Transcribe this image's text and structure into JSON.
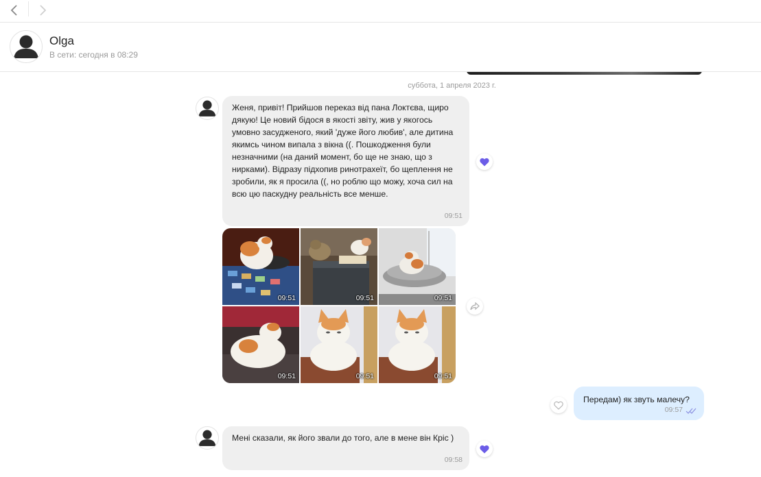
{
  "contact": {
    "name": "Olga",
    "status": "В сети: сегодня в 08:29"
  },
  "chat": {
    "date_separator": "суббота, 1 апреля 2023 г.",
    "messages": [
      {
        "direction": "in",
        "text": "Женя, привіт! Прийшов переказ від пана Локтєва, щиро дякую! Це новий бідося в якості звіту, жив у якогось умовно засудженого, який 'дуже його любив', але дитина якимсь чином випала з вікна ((. Пошкодження були незначними (на даний момент, бо ще не знаю, що з нирками). Відразу підхопив ринотрахеїт, бо щеплення не зробили, як я просила ((, но роблю що можу, хоча сил на всю цю паскудну реальність все менше.",
        "time": "09:51",
        "reaction": "heart-filled"
      },
      {
        "direction": "in",
        "type": "photo-grid",
        "photos": [
          {
            "time": "09:51",
            "subject": "white-orange cat eating from bowl"
          },
          {
            "time": "09:51",
            "subject": "two cats on box"
          },
          {
            "time": "09:51",
            "subject": "cat on cushion by window"
          },
          {
            "time": "09:51",
            "subject": "cat lying on blanket"
          },
          {
            "time": "09:51",
            "subject": "cat portrait"
          },
          {
            "time": "09:51",
            "subject": "cat portrait"
          }
        ],
        "action": "share"
      },
      {
        "direction": "out",
        "text": "Передам) як звуть малечу?",
        "time": "09:57",
        "read": true,
        "reaction": "heart-outline"
      },
      {
        "direction": "in",
        "text": "Мені сказали, як його звали до того, але в мене він Кріс )",
        "time": "09:58",
        "reaction": "heart-filled"
      }
    ]
  },
  "colors": {
    "incoming_bubble": "#efefef",
    "outgoing_bubble": "#ddeeff",
    "heart": "#6b5ce7",
    "read_checks": "#8a8fe0"
  }
}
